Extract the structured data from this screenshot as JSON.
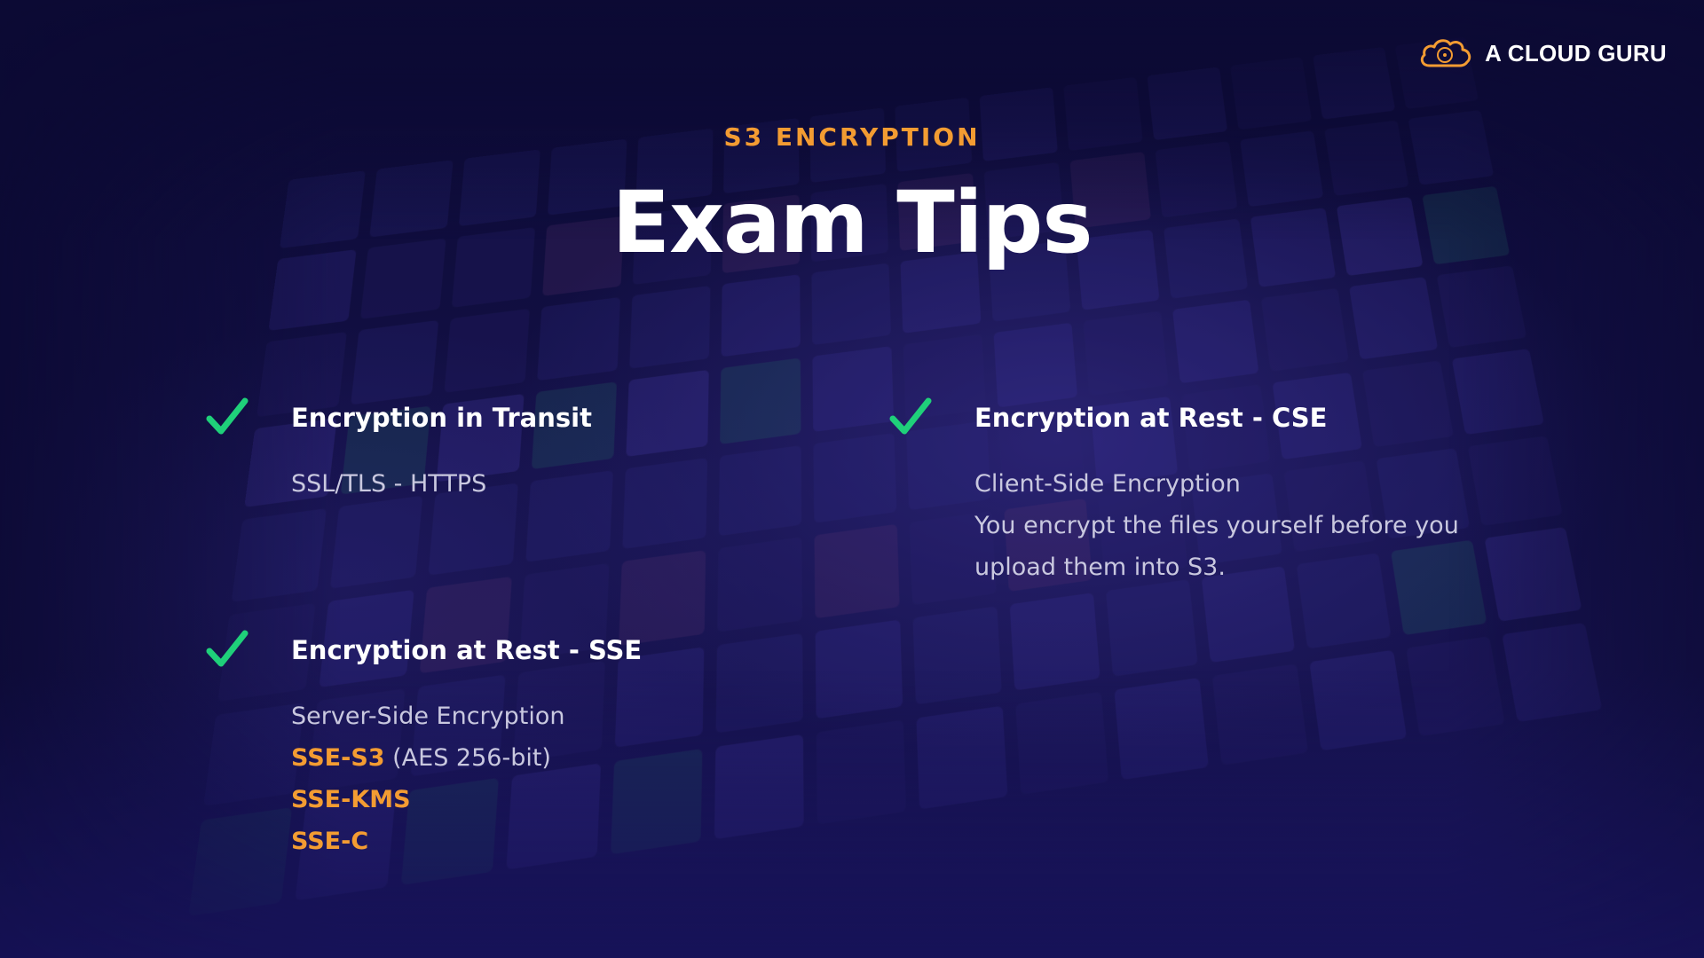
{
  "logo": {
    "text": "A CLOUD GURU",
    "icon": "cloud-logo-icon",
    "color": "#f39c32"
  },
  "header": {
    "eyebrow": "S3 ENCRYPTION",
    "title": "Exam Tips"
  },
  "colors": {
    "accent": "#f39c32",
    "check": "#1fd07a",
    "background": "#141149",
    "muted_text": "#c9c8df"
  },
  "tips": {
    "transit": {
      "icon": "checkmark-icon",
      "heading": "Encryption in Transit",
      "lines": [
        "SSL/TLS - HTTPS"
      ]
    },
    "sse": {
      "icon": "checkmark-icon",
      "heading": "Encryption at Rest - SSE",
      "intro": "Server-Side Encryption",
      "options": [
        {
          "label": "SSE-S3",
          "note": " (AES 256-bit)"
        },
        {
          "label": "SSE-KMS",
          "note": ""
        },
        {
          "label": "SSE-C",
          "note": ""
        }
      ]
    },
    "cse": {
      "icon": "checkmark-icon",
      "heading": "Encryption at Rest - CSE",
      "lines": [
        "Client-Side Encryption",
        "You encrypt the files yourself before you",
        "upload them into S3."
      ]
    }
  }
}
